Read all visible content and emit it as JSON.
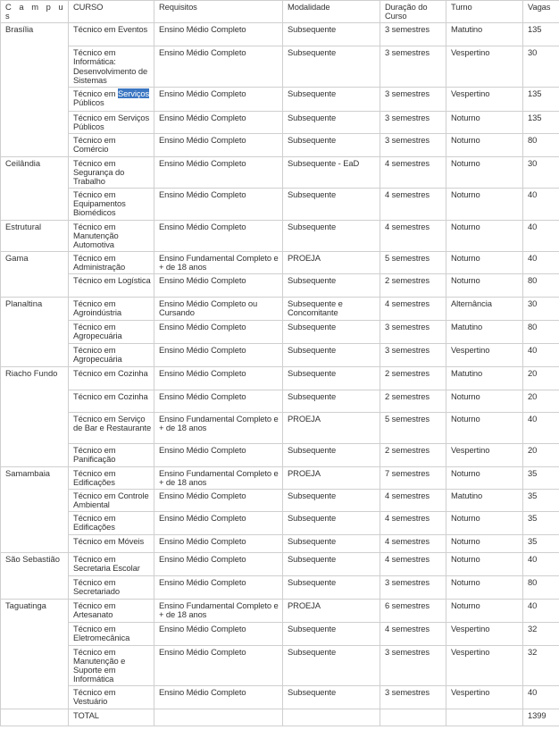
{
  "headers": [
    "C a m p u s",
    "CURSO",
    "Requisitos",
    "Modalidade",
    "Duração do Curso",
    "Turno",
    "Vagas"
  ],
  "groups": [
    {
      "campus": "Brasília",
      "rows": [
        {
          "curso": "Técnico em Eventos",
          "req": "Ensino Médio Completo",
          "mod": "Subsequente",
          "dur": "3 semestres",
          "turno": "Matutino",
          "vagas": "135"
        },
        {
          "curso": "Técnico em Informática: Desenvolvimento de Sistemas",
          "req": "Ensino Médio Completo",
          "mod": "Subsequente",
          "dur": "3 semestres",
          "turno": "Vespertino",
          "vagas": "30"
        },
        {
          "curso": "Técnico em Serviços Públicos",
          "highlight": "Serviços",
          "req": "Ensino Médio Completo",
          "mod": "Subsequente",
          "dur": "3 semestres",
          "turno": "Vespertino",
          "vagas": "135"
        },
        {
          "curso": "Técnico em Serviços Públicos",
          "req": "Ensino Médio Completo",
          "mod": "Subsequente",
          "dur": "3 semestres",
          "turno": "Noturno",
          "vagas": "135"
        },
        {
          "curso": "Técnico em Comércio",
          "req": "Ensino Médio Completo",
          "mod": "Subsequente",
          "dur": "3 semestres",
          "turno": "Noturno",
          "vagas": "80"
        }
      ]
    },
    {
      "campus": "Ceilândia",
      "rows": [
        {
          "curso": "Técnico em Segurança do Trabalho",
          "req": "Ensino Médio Completo",
          "mod": "Subsequente - EaD",
          "dur": "4 semestres",
          "turno": "Noturno",
          "vagas": "30"
        },
        {
          "curso": "Técnico em Equipamentos Biomédicos",
          "req": "Ensino Médio Completo",
          "mod": "Subsequente",
          "dur": "4 semestres",
          "turno": "Noturno",
          "vagas": "40"
        }
      ]
    },
    {
      "campus": "Estrutural",
      "rows": [
        {
          "curso": "Técnico em Manutenção Automotiva",
          "req": "Ensino Médio Completo",
          "mod": "Subsequente",
          "dur": "4 semestres",
          "turno": "Noturno",
          "vagas": "40"
        }
      ]
    },
    {
      "campus": "Gama",
      "rows": [
        {
          "curso": "Técnico em Administração",
          "req": "Ensino Fundamental Completo e + de 18 anos",
          "mod": "PROEJA",
          "dur": "5 semestres",
          "turno": "Noturno",
          "vagas": "40"
        },
        {
          "curso": "Técnico em Logística",
          "req": "Ensino Médio Completo",
          "mod": "Subsequente",
          "dur": "2 semestres",
          "turno": "Noturno",
          "vagas": "80"
        }
      ]
    },
    {
      "campus": "Planaltina",
      "rows": [
        {
          "curso": "Técnico em Agroindústria",
          "req": "Ensino Médio Completo ou Cursando",
          "mod": "Subsequente e Concomitante",
          "dur": "4 semestres",
          "turno": "Alternância",
          "vagas": "30"
        },
        {
          "curso": "Técnico em Agropecuária",
          "req": "Ensino Médio Completo",
          "mod": "Subsequente",
          "dur": "3 semestres",
          "turno": "Matutino",
          "vagas": "80"
        },
        {
          "curso": "Técnico em Agropecuária",
          "req": "Ensino Médio Completo",
          "mod": "Subsequente",
          "dur": "3 semestres",
          "turno": "Vespertino",
          "vagas": "40"
        }
      ]
    },
    {
      "campus": "Riacho Fundo",
      "rows": [
        {
          "curso": "Técnico em Cozinha",
          "req": "Ensino Médio Completo",
          "mod": "Subsequente",
          "dur": "2 semestres",
          "turno": "Matutino",
          "vagas": "20"
        },
        {
          "curso": "Técnico em Cozinha",
          "req": "Ensino Médio Completo",
          "mod": "Subsequente",
          "dur": "2 semestres",
          "turno": "Noturno",
          "vagas": "20"
        },
        {
          "curso": "Técnico em Serviço de Bar e Restaurante",
          "req": "Ensino Fundamental Completo e + de 18 anos",
          "mod": "PROEJA",
          "dur": "5 semestres",
          "turno": "Noturno",
          "vagas": "40"
        },
        {
          "curso": "Técnico em Panificação",
          "req": "Ensino Médio Completo",
          "mod": "Subsequente",
          "dur": "2 semestres",
          "turno": "Vespertino",
          "vagas": "20"
        }
      ]
    },
    {
      "campus": "Samambaia",
      "rows": [
        {
          "curso": "Técnico em Edificações",
          "req": "Ensino Fundamental Completo e + de 18 anos",
          "mod": "PROEJA",
          "dur": "7 semestres",
          "turno": "Noturno",
          "vagas": "35"
        },
        {
          "curso": "Técnico em Controle Ambiental",
          "req": "Ensino Médio Completo",
          "mod": "Subsequente",
          "dur": "4 semestres",
          "turno": "Matutino",
          "vagas": "35"
        },
        {
          "curso": "Técnico em Edificações",
          "req": "Ensino Médio Completo",
          "mod": "Subsequente",
          "dur": "4 semestres",
          "turno": "Noturno",
          "vagas": "35"
        },
        {
          "curso": "Técnico em Móveis",
          "req": "Ensino Médio Completo",
          "mod": "Subsequente",
          "dur": "4 semestres",
          "turno": "Noturno",
          "vagas": "35"
        }
      ]
    },
    {
      "campus": "São Sebastião",
      "rows": [
        {
          "curso": "Técnico em Secretaria Escolar",
          "req": "Ensino Médio Completo",
          "mod": "Subsequente",
          "dur": " 4 semestres",
          "turno": "Noturno",
          "vagas": "40"
        },
        {
          "curso": "Técnico em Secretariado",
          "req": "Ensino Médio Completo",
          "mod": "Subsequente",
          "dur": "3 semestres",
          "turno": "Noturno",
          "vagas": "80"
        }
      ]
    },
    {
      "campus": "Taguatinga",
      "rows": [
        {
          "curso": "Técnico em Artesanato",
          "req": "Ensino Fundamental Completo e + de 18 anos",
          "mod": "PROEJA",
          "dur": "6 semestres",
          "turno": "Noturno",
          "vagas": "40"
        },
        {
          "curso": "Técnico em Eletromecânica",
          "req": "Ensino Médio Completo",
          "mod": "Subsequente",
          "dur": "4 semestres",
          "turno": "Vespertino",
          "vagas": "32"
        },
        {
          "curso": "Técnico em Manutenção e Suporte em Informática",
          "req": "Ensino Médio Completo",
          "mod": "Subsequente",
          "dur": "3 semestres",
          "turno": "Vespertino",
          "vagas": "32"
        },
        {
          "curso": "Técnico em Vestuário",
          "req": "Ensino Médio Completo",
          "mod": "Subsequente",
          "dur": "3 semestres",
          "turno": "Vespertino",
          "vagas": "40"
        }
      ]
    }
  ],
  "total": {
    "label": "TOTAL",
    "vagas": "1399"
  }
}
